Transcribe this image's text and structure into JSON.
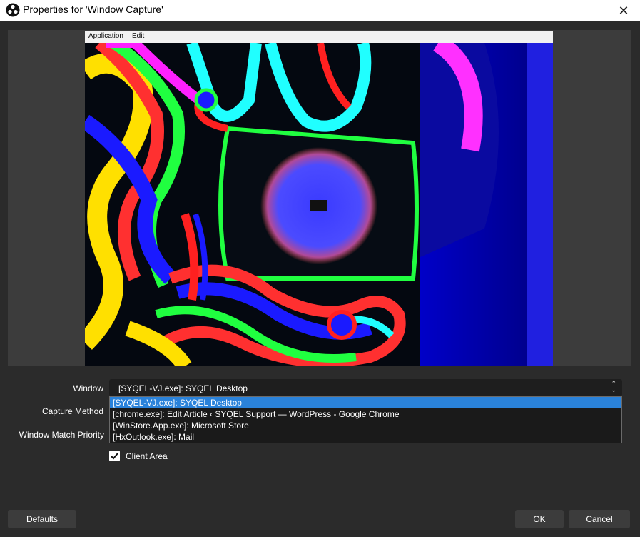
{
  "window": {
    "title": "Properties for 'Window Capture'",
    "close_icon": "close-icon"
  },
  "preview": {
    "menu": [
      "Application",
      "Edit"
    ]
  },
  "form": {
    "window_label": "Window",
    "window_value": "[SYQEL-VJ.exe]: SYQEL Desktop",
    "capture_method_label": "Capture Method",
    "window_match_priority_label": "Window Match Priority",
    "dropdown_options": [
      "[SYQEL-VJ.exe]: SYQEL Desktop",
      "[chrome.exe]: Edit Article ‹ SYQEL Support — WordPress - Google Chrome",
      "[WinStore.App.exe]: Microsoft Store",
      "[HxOutlook.exe]: Mail"
    ],
    "client_area_label": "Client Area",
    "client_area_checked": true
  },
  "buttons": {
    "defaults": "Defaults",
    "ok": "OK",
    "cancel": "Cancel"
  },
  "colors": {
    "selection": "#2a82da",
    "dialog_bg": "#2b2b2b"
  }
}
